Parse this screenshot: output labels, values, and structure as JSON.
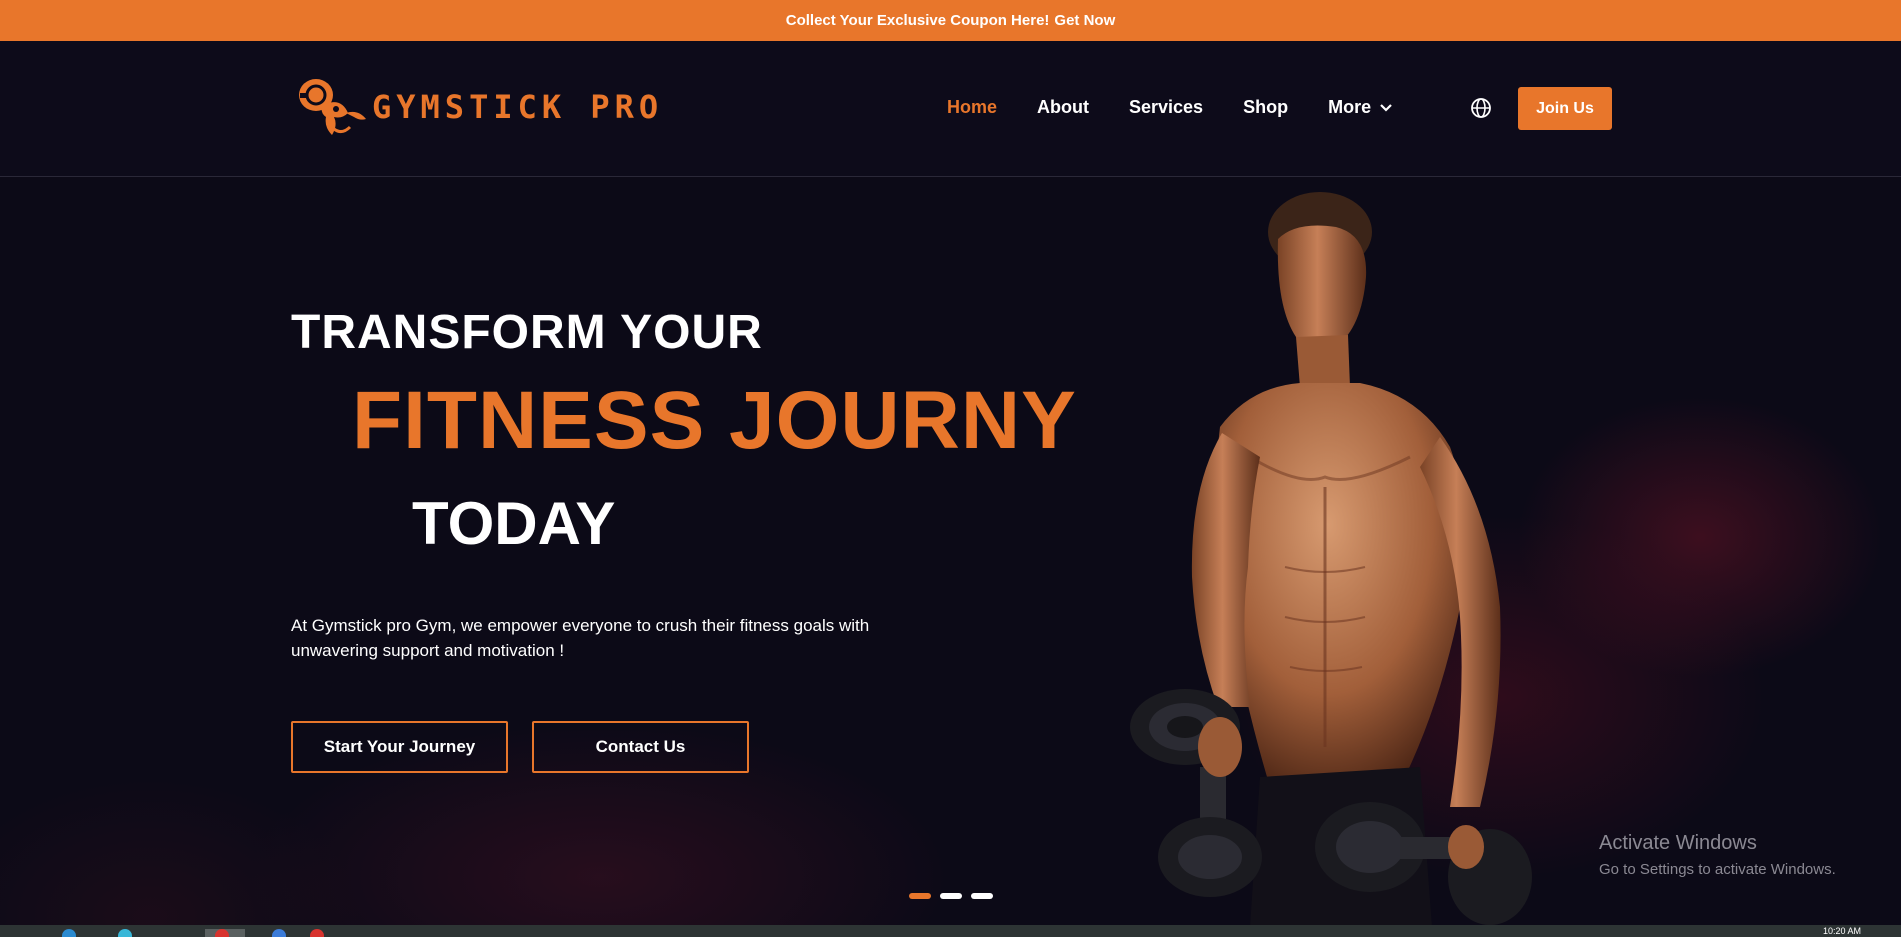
{
  "promo": {
    "text": "Collect Your Exclusive Coupon Here!",
    "cta": "Get Now"
  },
  "brand": {
    "name": "GYMSTICK PRO"
  },
  "nav": {
    "items": [
      {
        "label": "Home",
        "active": true
      },
      {
        "label": "About"
      },
      {
        "label": "Services"
      },
      {
        "label": "Shop"
      },
      {
        "label": "More"
      }
    ],
    "join_label": "Join Us"
  },
  "hero": {
    "line1": "TRANSFORM YOUR",
    "line2": "FITNESS JOURNY",
    "line3": "TODAY",
    "description": "At Gymstick pro Gym, we empower everyone to crush their fitness goals with unwavering support and motivation !",
    "buttons": {
      "start": "Start Your Journey",
      "contact": "Contact Us"
    },
    "slides": {
      "count": 3,
      "active": 1
    }
  },
  "watermark": {
    "title": "Activate Windows",
    "subtitle": "Go to Settings to activate Windows."
  },
  "taskbar": {
    "time": "10:20 AM"
  },
  "colors": {
    "accent": "#e8762b",
    "background": "#0c0a17",
    "nav_bg": "#0d0b1a"
  },
  "icons": {
    "language": "globe-icon",
    "more": "chevron-down-icon"
  }
}
